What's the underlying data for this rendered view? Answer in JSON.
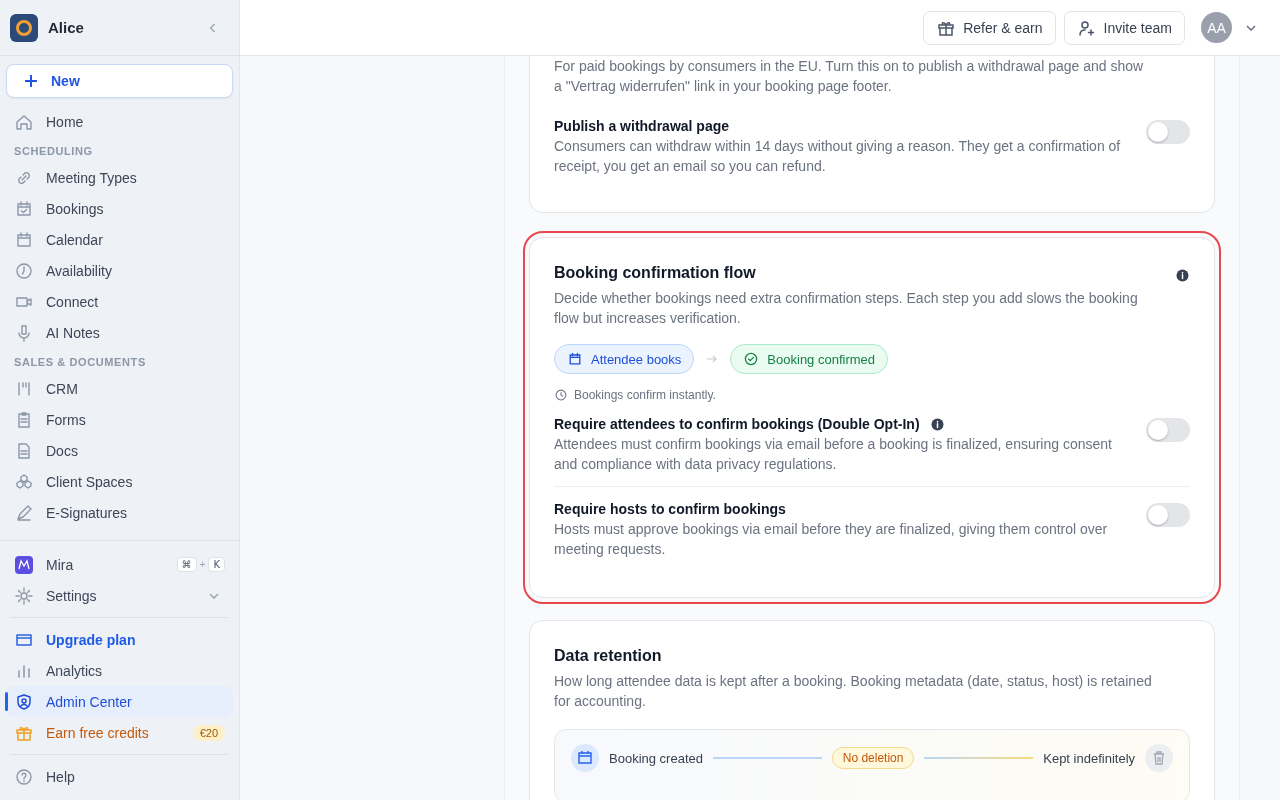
{
  "sidebar": {
    "workspace": "Alice",
    "new_button": "New",
    "sections": [
      {
        "items": [
          {
            "label": "Home",
            "selected": false
          }
        ]
      },
      {
        "heading": "SCHEDULING",
        "items": [
          {
            "label": "Meeting Types",
            "selected": false
          },
          {
            "label": "Bookings",
            "selected": false
          },
          {
            "label": "Calendar",
            "selected": false
          },
          {
            "label": "Availability",
            "selected": false
          },
          {
            "label": "Connect",
            "selected": false
          },
          {
            "label": "AI Notes",
            "selected": false
          }
        ]
      },
      {
        "heading": "SALES & DOCUMENTS",
        "items": [
          {
            "label": "CRM",
            "selected": false
          },
          {
            "label": "Forms",
            "selected": false
          },
          {
            "label": "Docs",
            "selected": false
          },
          {
            "label": "Client Spaces",
            "selected": false
          },
          {
            "label": "E-Signatures",
            "selected": false
          }
        ]
      }
    ],
    "assistant": {
      "label": "Mira",
      "keys": [
        "⌘",
        "+",
        "K"
      ]
    },
    "settings": {
      "label": "Settings",
      "expanded": false
    },
    "bottom_items": [
      {
        "label": "Upgrade plan",
        "kind": "upgrade",
        "selected": false
      },
      {
        "label": "Analytics",
        "kind": "normal",
        "selected": false
      },
      {
        "label": "Admin Center",
        "kind": "normal",
        "selected": true
      },
      {
        "label": "Earn free credits",
        "kind": "promo",
        "selected": false,
        "badge": "€20"
      }
    ],
    "help": "Help"
  },
  "header": {
    "buttons": [
      "Refer & earn",
      "Invite team"
    ],
    "avatar": "AA"
  },
  "cards": [
    {
      "kind": "plain",
      "highlighted": false,
      "intro": "For paid bookings by consumers in the EU. Turn this on to publish a withdrawal page and show a \"Vertrag widerrufen\" link in your booking page footer.",
      "settings": [
        {
          "title": "Publish a withdrawal page",
          "info": false,
          "description": "Consumers can withdraw within 14 days without giving a reason. They get a confirmation of receipt, you get an email so you can refund.",
          "on": false
        }
      ]
    },
    {
      "kind": "flow",
      "highlighted": true,
      "title": "Booking confirmation flow",
      "description": "Decide whether bookings need extra confirmation steps. Each step you add slows the booking flow but increases verification.",
      "steps": [
        {
          "label": "Attendee books",
          "kind": "start"
        },
        {
          "label": "Booking confirmed",
          "kind": "done"
        }
      ],
      "note": "Bookings confirm instantly.",
      "settings": [
        {
          "title": "Require attendees to confirm bookings (Double Opt-In)",
          "info": true,
          "description": "Attendees must confirm bookings via email before a booking is finalized, ensuring consent and compliance with data privacy regulations.",
          "on": false
        },
        {
          "title": "Require hosts to confirm bookings",
          "info": false,
          "description": "Hosts must approve bookings via email before they are finalized, giving them control over meeting requests.",
          "on": false
        }
      ]
    },
    {
      "kind": "retention",
      "highlighted": false,
      "title": "Data retention",
      "description": "How long attendee data is kept after a booking. Booking metadata (date, status, host) is retained for accounting.",
      "timeline": {
        "start": "Booking created",
        "policy": "No deletion",
        "end": "Kept indefinitely"
      }
    }
  ]
}
